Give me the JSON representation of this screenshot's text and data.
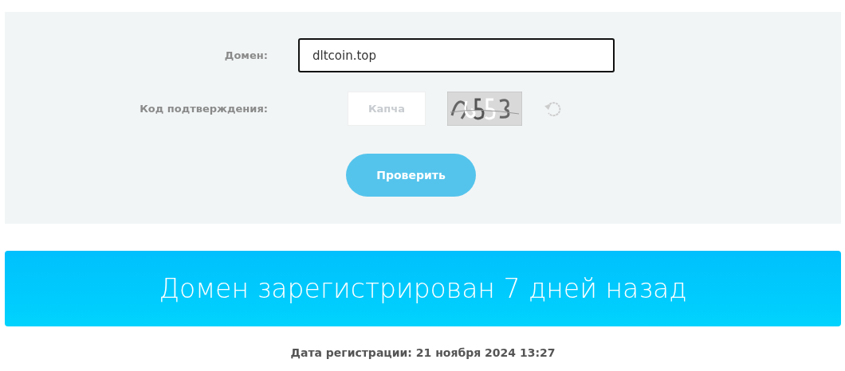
{
  "form": {
    "domain": {
      "label": "Домен:",
      "value": "dltcoin.top",
      "focused": true
    },
    "captcha": {
      "label": "Код подтверждения:",
      "placeholder": "Капча"
    },
    "submit": "Проверить"
  },
  "result": {
    "message": "Домен зарегистрирован 7 дней назад",
    "details": "Дата регистрации: 21 ноября 2024 13:27"
  }
}
